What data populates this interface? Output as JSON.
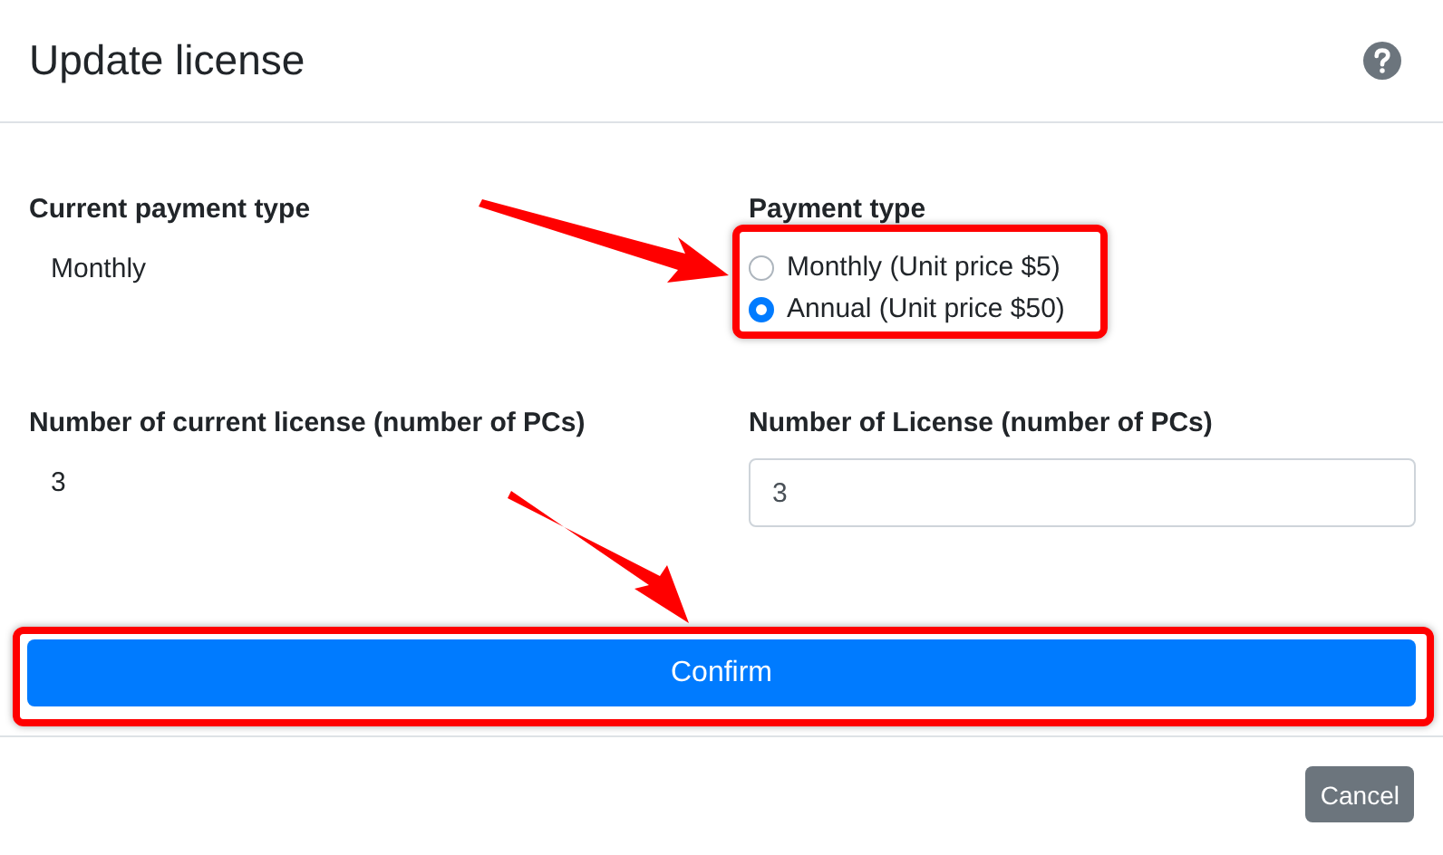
{
  "title": "Update license",
  "current_payment": {
    "label": "Current payment type",
    "value": "Monthly"
  },
  "payment_type": {
    "label": "Payment type",
    "options": [
      {
        "label": "Monthly (Unit price $5)",
        "selected": false
      },
      {
        "label": "Annual (Unit price $50)",
        "selected": true
      }
    ]
  },
  "current_license": {
    "label": "Number of current license (number of PCs)",
    "value": "3"
  },
  "license_count": {
    "label": "Number of License (number of PCs)",
    "value": "3"
  },
  "confirm": "Confirm",
  "cancel": "Cancel"
}
